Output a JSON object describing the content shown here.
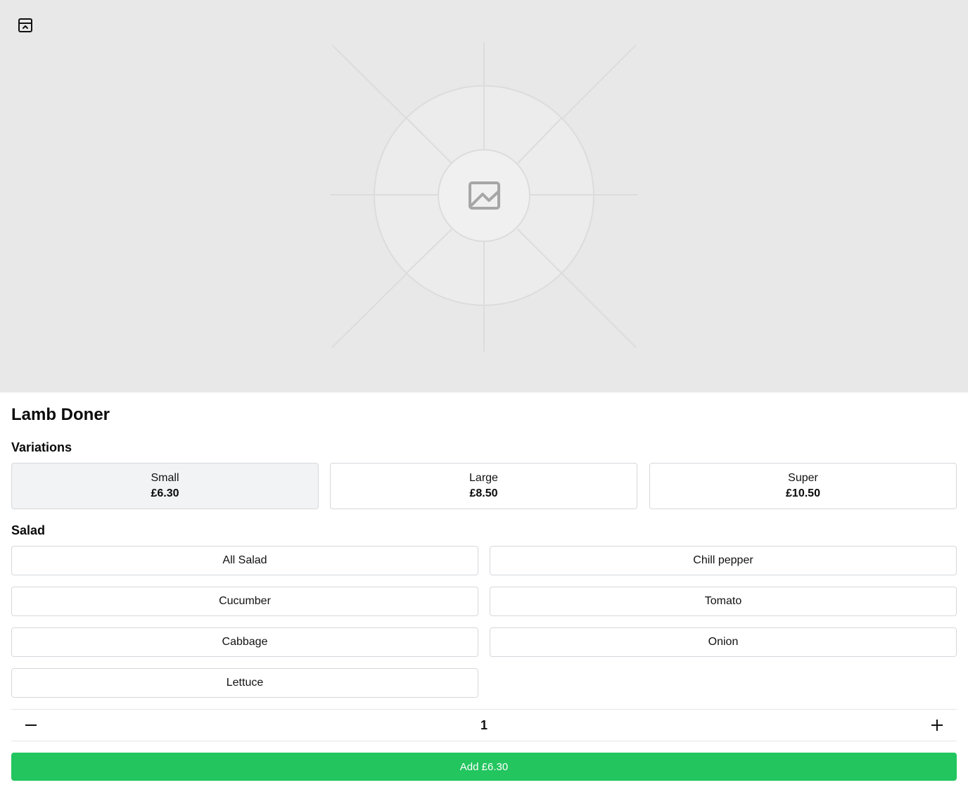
{
  "product": {
    "image_icon": "image-placeholder-icon",
    "collapse_icon": "panel-collapse-icon",
    "name": "Lamb Doner"
  },
  "variations": {
    "title": "Variations",
    "selected_index": 0,
    "items": [
      {
        "name": "Small",
        "price": "£6.30"
      },
      {
        "name": "Large",
        "price": "£8.50"
      },
      {
        "name": "Super",
        "price": "£10.50"
      }
    ]
  },
  "salad": {
    "title": "Salad",
    "items": [
      "All Salad",
      "Chill pepper",
      "Cucumber",
      "Tomato",
      "Cabbage",
      "Onion",
      "Lettuce"
    ]
  },
  "quantity": {
    "value": "1",
    "decrement_icon": "minus-icon",
    "increment_icon": "plus-icon"
  },
  "add_button": {
    "label": "Add £6.30",
    "color": "#22c55e"
  },
  "colors": {
    "hero_background": "#e8e8e8",
    "selected_variation": "#f2f3f5"
  }
}
